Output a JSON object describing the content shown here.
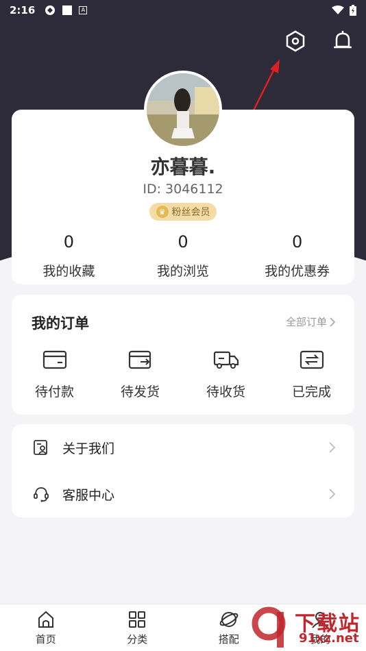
{
  "status_bar": {
    "time": "2:16"
  },
  "profile": {
    "username": "亦暮暮.",
    "id_text": "ID: 3046112",
    "badge": "粉丝会员",
    "stats": [
      {
        "value": "0",
        "label": "我的收藏"
      },
      {
        "value": "0",
        "label": "我的浏览"
      },
      {
        "value": "0",
        "label": "我的优惠券"
      }
    ]
  },
  "orders": {
    "title": "我的订单",
    "all_label": "全部订单",
    "items": [
      {
        "label": "待付款",
        "icon": "wallet-icon"
      },
      {
        "label": "待发货",
        "icon": "ship-out-icon"
      },
      {
        "label": "待收货",
        "icon": "truck-icon"
      },
      {
        "label": "已完成",
        "icon": "completed-icon"
      }
    ]
  },
  "menu": [
    {
      "label": "关于我们",
      "icon": "about-icon"
    },
    {
      "label": "客服中心",
      "icon": "headset-icon"
    }
  ],
  "tabbar": [
    {
      "label": "首页",
      "icon": "home-icon"
    },
    {
      "label": "分类",
      "icon": "grid-icon"
    },
    {
      "label": "搭配",
      "icon": "planet-icon"
    },
    {
      "label": "我的",
      "icon": "user-icon"
    }
  ],
  "watermark": {
    "title": "下载站",
    "url": "91xz.net"
  },
  "colors": {
    "header": "#2d2a3a",
    "badge_bg": "#f3dca5",
    "arrow": "#e02020",
    "brand_red": "#c0262b"
  }
}
